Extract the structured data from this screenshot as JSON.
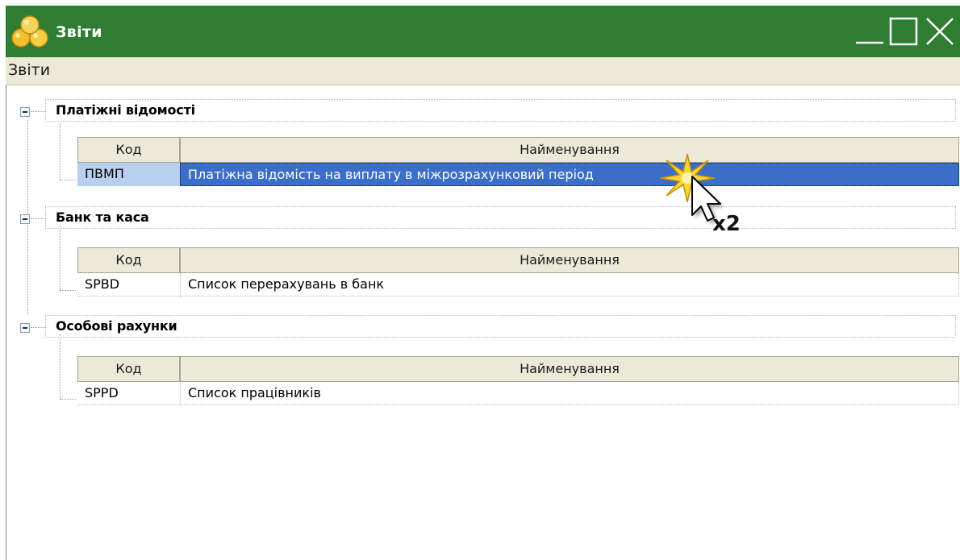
{
  "window": {
    "title": "Звіти",
    "controls": [
      "minimize-icon",
      "maximize-icon",
      "close-icon"
    ]
  },
  "menu": {
    "items": [
      {
        "label": "Звіти"
      }
    ]
  },
  "colors": {
    "titlebar": "#2e7d32",
    "menubar": "#ece9d8",
    "selected_row": "#3a6ec8",
    "selected_code": "#b9cff0"
  },
  "groups": [
    {
      "title": "Платіжні відомості",
      "columns": {
        "code": "Код",
        "name": "Найменування"
      },
      "rows": [
        {
          "code": "ПВМП",
          "name": "Платіжна відомість на виплату в міжрозрахунковий період",
          "selected": true
        }
      ]
    },
    {
      "title": "Банк та каса",
      "columns": {
        "code": "Код",
        "name": "Найменування"
      },
      "rows": [
        {
          "code": "SPBD",
          "name": "Список перерахувань в банк",
          "selected": false
        }
      ]
    },
    {
      "title": "Особові рахунки",
      "columns": {
        "code": "Код",
        "name": "Найменування"
      },
      "rows": [
        {
          "code": "SPPD",
          "name": "Список працівників",
          "selected": false
        }
      ]
    }
  ],
  "annotation": {
    "cursor_icon": "pointer-cursor-icon",
    "click_label": "x2"
  }
}
